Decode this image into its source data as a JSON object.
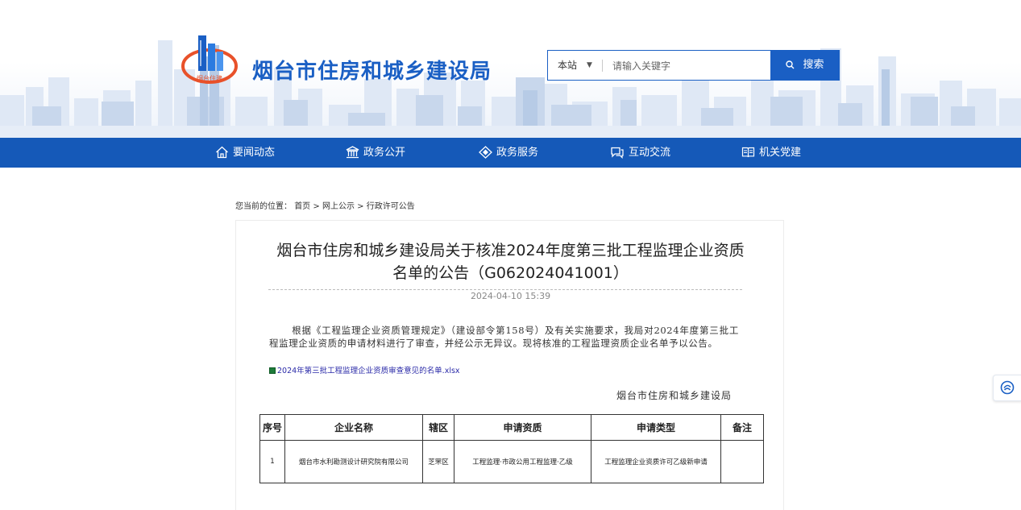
{
  "site": {
    "title": "烟台市住房和城乡建设局",
    "logo_text": "烟台住建"
  },
  "search": {
    "scope_label": "本站",
    "placeholder": "请输入关键字",
    "button_label": "搜索"
  },
  "nav": {
    "items": [
      {
        "label": "要闻动态",
        "icon": "home-icon"
      },
      {
        "label": "政务公开",
        "icon": "government-building-icon"
      },
      {
        "label": "政务服务",
        "icon": "service-diamond-icon"
      },
      {
        "label": "互动交流",
        "icon": "chat-bubble-icon"
      },
      {
        "label": "机关党建",
        "icon": "book-icon"
      }
    ]
  },
  "breadcrumb": {
    "prefix": "您当前的位置：",
    "items": [
      "首页",
      "网上公示",
      "行政许可公告"
    ],
    "separator": ">"
  },
  "article": {
    "title_line1": "烟台市住房和城乡建设局关于核准2024年度第三批工程监理企业资质",
    "title_line2": "名单的公告（G062024041001）",
    "date": "2024-04-10 15:39",
    "body": "根据《工程监理企业资质管理规定》（建设部令第158号）及有关实施要求，我局对2024年度第三批工程监理企业资质的申请材料进行了审查，并经公示无异议。现将核准的工程监理资质企业名单予以公告。",
    "attachment": "2024年第三批工程监理企业资质审查意见的名单.xlsx",
    "signature": "烟台市住房和城乡建设局"
  },
  "table": {
    "headers": [
      "序号",
      "企业名称",
      "辖区",
      "申请资质",
      "申请类型",
      "备注"
    ],
    "rows": [
      [
        "1",
        "烟台市水利勘测设计研究院有限公司",
        "芝罘区",
        "工程监理·市政公用工程监理·乙级",
        "工程监理企业资质许可乙级新申请",
        ""
      ]
    ]
  },
  "colors": {
    "brand_blue": "#1a5fc4",
    "nav_blue": "#1559b8",
    "logo_orange": "#e8512a"
  }
}
